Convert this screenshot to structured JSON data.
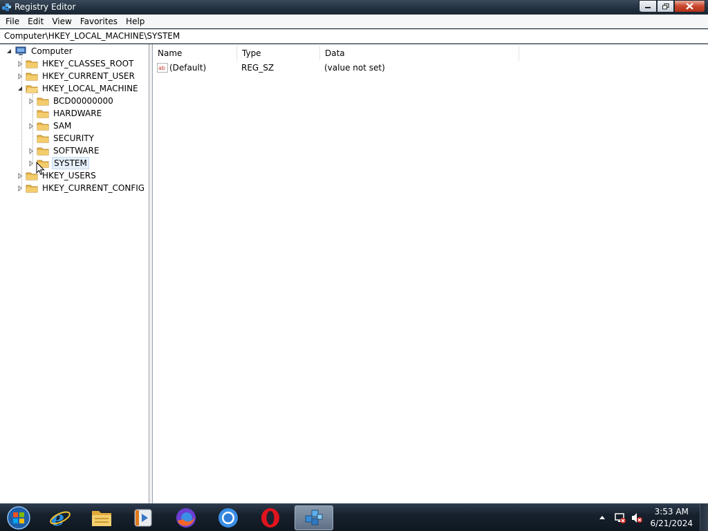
{
  "window": {
    "title": "Registry Editor",
    "icon": "regedit-icon",
    "controls": {
      "minimize": "minimize-icon",
      "maximize": "restore-icon",
      "close": "close-icon"
    }
  },
  "menu": [
    "File",
    "Edit",
    "View",
    "Favorites",
    "Help"
  ],
  "address": "Computer\\HKEY_LOCAL_MACHINE\\SYSTEM",
  "tree": {
    "root": "Computer",
    "items": [
      {
        "label": "HKEY_CLASSES_ROOT",
        "level": 1,
        "expander": "collapsed"
      },
      {
        "label": "HKEY_CURRENT_USER",
        "level": 1,
        "expander": "collapsed"
      },
      {
        "label": "HKEY_LOCAL_MACHINE",
        "level": 1,
        "expander": "expanded"
      },
      {
        "label": "BCD00000000",
        "level": 2,
        "expander": "collapsed"
      },
      {
        "label": "HARDWARE",
        "level": 2,
        "expander": "none"
      },
      {
        "label": "SAM",
        "level": 2,
        "expander": "collapsed"
      },
      {
        "label": "SECURITY",
        "level": 2,
        "expander": "none"
      },
      {
        "label": "SOFTWARE",
        "level": 2,
        "expander": "collapsed"
      },
      {
        "label": "SYSTEM",
        "level": 2,
        "expander": "collapsed",
        "selected": true
      },
      {
        "label": "HKEY_USERS",
        "level": 1,
        "expander": "collapsed"
      },
      {
        "label": "HKEY_CURRENT_CONFIG",
        "level": 1,
        "expander": "collapsed"
      }
    ]
  },
  "list": {
    "columns": [
      "Name",
      "Type",
      "Data"
    ],
    "rows": [
      {
        "icon": "string-value-icon",
        "name": "(Default)",
        "type": "REG_SZ",
        "data": "(value not set)"
      }
    ]
  },
  "taskbar": {
    "apps": [
      "start-orb-icon",
      "internet-explorer-icon",
      "file-explorer-icon",
      "media-player-icon",
      "firefox-icon",
      "chrome-icon",
      "opera-icon",
      "regedit-icon"
    ],
    "active_app": "regedit-icon",
    "tray": [
      "show-hidden-icons-icon",
      "network-disconnected-icon",
      "speaker-muted-icon"
    ],
    "time": "3:53 AM",
    "date": "6/21/2024"
  },
  "colors": {
    "selection": "#e5f0fb",
    "folder": "#e8b64a",
    "close_button": "#c9462c"
  }
}
